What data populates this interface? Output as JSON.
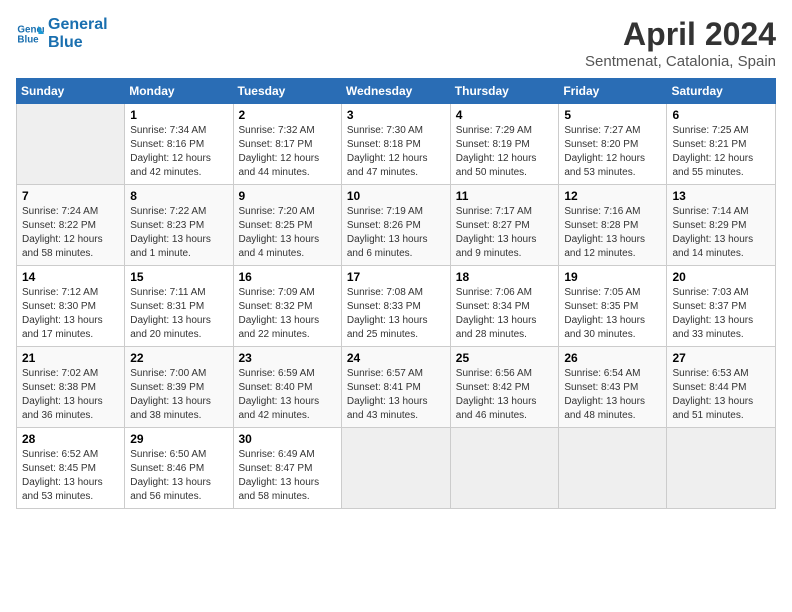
{
  "header": {
    "logo_line1": "General",
    "logo_line2": "Blue",
    "month_year": "April 2024",
    "location": "Sentmenat, Catalonia, Spain"
  },
  "days_of_week": [
    "Sunday",
    "Monday",
    "Tuesday",
    "Wednesday",
    "Thursday",
    "Friday",
    "Saturday"
  ],
  "weeks": [
    [
      {
        "day": "",
        "empty": true
      },
      {
        "day": "1",
        "sunrise": "7:34 AM",
        "sunset": "8:16 PM",
        "daylight": "12 hours and 42 minutes."
      },
      {
        "day": "2",
        "sunrise": "7:32 AM",
        "sunset": "8:17 PM",
        "daylight": "12 hours and 44 minutes."
      },
      {
        "day": "3",
        "sunrise": "7:30 AM",
        "sunset": "8:18 PM",
        "daylight": "12 hours and 47 minutes."
      },
      {
        "day": "4",
        "sunrise": "7:29 AM",
        "sunset": "8:19 PM",
        "daylight": "12 hours and 50 minutes."
      },
      {
        "day": "5",
        "sunrise": "7:27 AM",
        "sunset": "8:20 PM",
        "daylight": "12 hours and 53 minutes."
      },
      {
        "day": "6",
        "sunrise": "7:25 AM",
        "sunset": "8:21 PM",
        "daylight": "12 hours and 55 minutes."
      }
    ],
    [
      {
        "day": "7",
        "sunrise": "7:24 AM",
        "sunset": "8:22 PM",
        "daylight": "12 hours and 58 minutes."
      },
      {
        "day": "8",
        "sunrise": "7:22 AM",
        "sunset": "8:23 PM",
        "daylight": "13 hours and 1 minute."
      },
      {
        "day": "9",
        "sunrise": "7:20 AM",
        "sunset": "8:25 PM",
        "daylight": "13 hours and 4 minutes."
      },
      {
        "day": "10",
        "sunrise": "7:19 AM",
        "sunset": "8:26 PM",
        "daylight": "13 hours and 6 minutes."
      },
      {
        "day": "11",
        "sunrise": "7:17 AM",
        "sunset": "8:27 PM",
        "daylight": "13 hours and 9 minutes."
      },
      {
        "day": "12",
        "sunrise": "7:16 AM",
        "sunset": "8:28 PM",
        "daylight": "13 hours and 12 minutes."
      },
      {
        "day": "13",
        "sunrise": "7:14 AM",
        "sunset": "8:29 PM",
        "daylight": "13 hours and 14 minutes."
      }
    ],
    [
      {
        "day": "14",
        "sunrise": "7:12 AM",
        "sunset": "8:30 PM",
        "daylight": "13 hours and 17 minutes."
      },
      {
        "day": "15",
        "sunrise": "7:11 AM",
        "sunset": "8:31 PM",
        "daylight": "13 hours and 20 minutes."
      },
      {
        "day": "16",
        "sunrise": "7:09 AM",
        "sunset": "8:32 PM",
        "daylight": "13 hours and 22 minutes."
      },
      {
        "day": "17",
        "sunrise": "7:08 AM",
        "sunset": "8:33 PM",
        "daylight": "13 hours and 25 minutes."
      },
      {
        "day": "18",
        "sunrise": "7:06 AM",
        "sunset": "8:34 PM",
        "daylight": "13 hours and 28 minutes."
      },
      {
        "day": "19",
        "sunrise": "7:05 AM",
        "sunset": "8:35 PM",
        "daylight": "13 hours and 30 minutes."
      },
      {
        "day": "20",
        "sunrise": "7:03 AM",
        "sunset": "8:37 PM",
        "daylight": "13 hours and 33 minutes."
      }
    ],
    [
      {
        "day": "21",
        "sunrise": "7:02 AM",
        "sunset": "8:38 PM",
        "daylight": "13 hours and 36 minutes."
      },
      {
        "day": "22",
        "sunrise": "7:00 AM",
        "sunset": "8:39 PM",
        "daylight": "13 hours and 38 minutes."
      },
      {
        "day": "23",
        "sunrise": "6:59 AM",
        "sunset": "8:40 PM",
        "daylight": "13 hours and 42 minutes."
      },
      {
        "day": "24",
        "sunrise": "6:57 AM",
        "sunset": "8:41 PM",
        "daylight": "13 hours and 43 minutes."
      },
      {
        "day": "25",
        "sunrise": "6:56 AM",
        "sunset": "8:42 PM",
        "daylight": "13 hours and 46 minutes."
      },
      {
        "day": "26",
        "sunrise": "6:54 AM",
        "sunset": "8:43 PM",
        "daylight": "13 hours and 48 minutes."
      },
      {
        "day": "27",
        "sunrise": "6:53 AM",
        "sunset": "8:44 PM",
        "daylight": "13 hours and 51 minutes."
      }
    ],
    [
      {
        "day": "28",
        "sunrise": "6:52 AM",
        "sunset": "8:45 PM",
        "daylight": "13 hours and 53 minutes."
      },
      {
        "day": "29",
        "sunrise": "6:50 AM",
        "sunset": "8:46 PM",
        "daylight": "13 hours and 56 minutes."
      },
      {
        "day": "30",
        "sunrise": "6:49 AM",
        "sunset": "8:47 PM",
        "daylight": "13 hours and 58 minutes."
      },
      {
        "day": "",
        "empty": true
      },
      {
        "day": "",
        "empty": true
      },
      {
        "day": "",
        "empty": true
      },
      {
        "day": "",
        "empty": true
      }
    ]
  ],
  "labels": {
    "sunrise": "Sunrise:",
    "sunset": "Sunset:",
    "daylight": "Daylight:"
  }
}
